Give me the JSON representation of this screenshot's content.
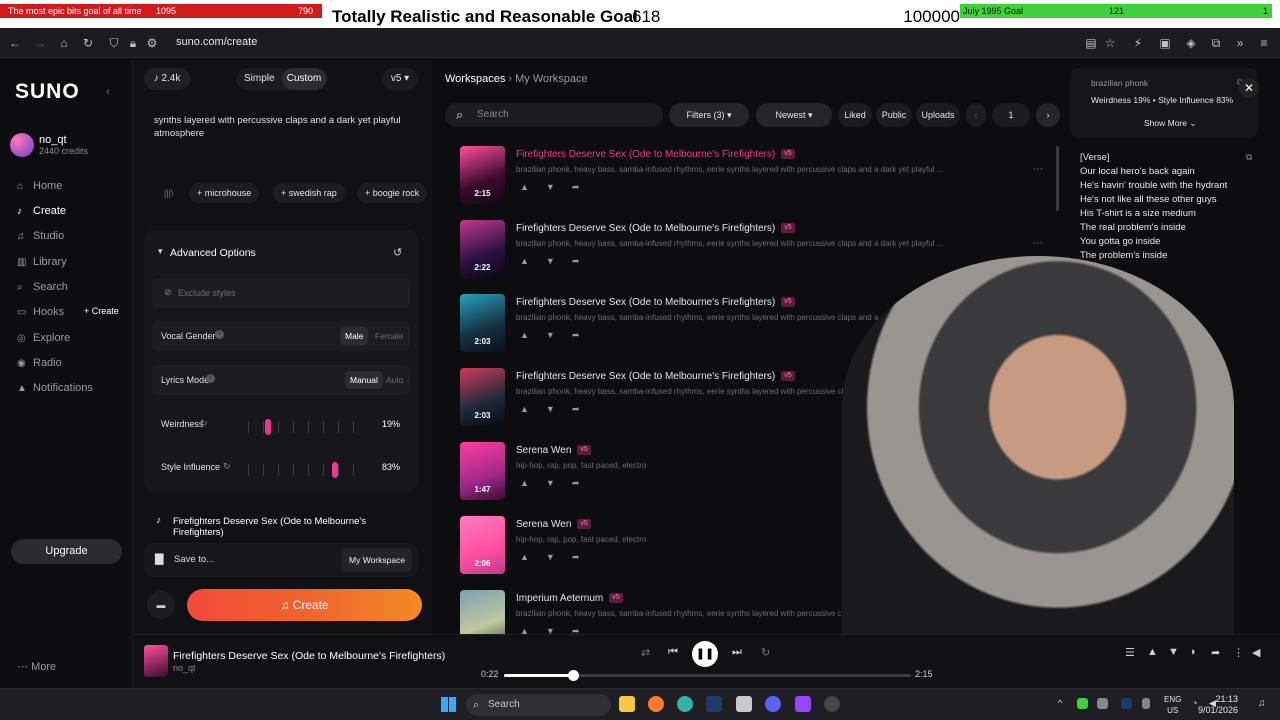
{
  "overlay": {
    "bits_goal_title": "The most epic bits goal of all time",
    "bits_goal_count": "1095",
    "bits_goal_max": "790",
    "main_goal_title": "Totally Realistic and Reasonable Goal",
    "main_goal_count": "618",
    "main_goal_max": "100000",
    "july_goal_title": "July 1995 Goal",
    "july_goal_count": "121",
    "july_goal_max": "1"
  },
  "browser": {
    "url": "suno.com/create"
  },
  "sidebar": {
    "logo": "SUNO",
    "username": "no_qt",
    "credits": "2440 credits",
    "items": [
      {
        "label": "Home",
        "icon": "home-icon"
      },
      {
        "label": "Create",
        "icon": "create-icon"
      },
      {
        "label": "Studio",
        "icon": "studio-icon"
      },
      {
        "label": "Library",
        "icon": "library-icon"
      },
      {
        "label": "Search",
        "icon": "search-icon"
      },
      {
        "label": "Hooks",
        "icon": "hooks-icon"
      },
      {
        "label": "Explore",
        "icon": "explore-icon"
      },
      {
        "label": "Radio",
        "icon": "radio-icon"
      },
      {
        "label": "Notifications",
        "icon": "bell-icon"
      }
    ],
    "hooks_create": "+ Create",
    "upgrade": "Upgrade",
    "more": "More"
  },
  "create": {
    "count": "2.4k",
    "mode_simple": "Simple",
    "mode_custom": "Custom",
    "version": "v5",
    "style_text": "synths layered with percussive claps and a dark yet playful atmosphere",
    "tags": [
      "microhouse",
      "swedish rap",
      "boogie rock"
    ],
    "advanced_label": "Advanced Options",
    "exclude_placeholder": "Exclude styles",
    "vocal_gender_label": "Vocal Gender",
    "vocal_male": "Male",
    "vocal_female": "Female",
    "lyrics_mode_label": "Lyrics Mode",
    "lyrics_manual": "Manual",
    "lyrics_auto": "Auto",
    "weirdness_label": "Weirdness",
    "weirdness_value": "19%",
    "weirdness_level": 0.19,
    "style_influence_label": "Style Influence",
    "style_influence_value": "83%",
    "style_influence_level": 0.83,
    "song_title": "Firefighters Deserve Sex (Ode to Melbourne's Firefighters)",
    "save_to": "Save to...",
    "workspace": "My Workspace",
    "create_button": "Create"
  },
  "workspace": {
    "breadcrumb_root": "Workspaces",
    "breadcrumb_current": "My Workspace",
    "search_placeholder": "Search",
    "filters": "Filters (3)",
    "sort": "Newest",
    "liked": "Liked",
    "public": "Public",
    "uploads": "Uploads",
    "page": "1",
    "tracks": [
      {
        "title": "Firefighters Deserve Sex (Ode to Melbourne's Firefighters)",
        "badge": "v5",
        "tags": "brazilian phonk, heavy bass, samba-infused rhythms, eerie synths layered with percussive claps and a dark yet playful ...",
        "duration": "2:15",
        "active": true
      },
      {
        "title": "Firefighters Deserve Sex (Ode to Melbourne's Firefighters)",
        "badge": "v5",
        "tags": "brazilian phonk, heavy bass, samba-infused rhythms, eerie synths layered with percussive claps and a dark yet playful ...",
        "duration": "2:22",
        "active": false
      },
      {
        "title": "Firefighters Deserve Sex (Ode to Melbourne's Firefighters)",
        "badge": "v5",
        "tags": "brazilian phonk, heavy bass, samba-infused rhythms, eerie synths layered with percussive claps and a dark yet playful ...",
        "duration": "2:03",
        "active": false
      },
      {
        "title": "Firefighters Deserve Sex (Ode to Melbourne's Firefighters)",
        "badge": "v5",
        "tags": "brazilian phonk, heavy bass, samba-infused rhythms, eerie synths layered with percussive claps and a dark yet playful ...",
        "duration": "2:03",
        "active": false
      },
      {
        "title": "Serena Wen",
        "badge": "v5",
        "tags": "hip-hop, rap, pop, fast paced, electro",
        "duration": "1:47",
        "active": false
      },
      {
        "title": "Serena Wen",
        "badge": "v5",
        "tags": "hip-hop, rap, pop, fast paced, electro",
        "duration": "2:06",
        "active": false
      },
      {
        "title": "Imperium Aeternum",
        "badge": "v5",
        "tags": "brazilian phonk, heavy bass, samba-infused rhythms, eerie synths layered with percussive claps and a dark yet playful ...",
        "duration": "",
        "active": false
      }
    ]
  },
  "details": {
    "style": "brazilian phonk",
    "params": "Weirdness 19% • Style Influence 83%",
    "show_more": "Show More",
    "lyrics": [
      "[Verse]",
      "Our local hero's back again",
      "He's havin' trouble with the hydrant",
      "He's not like all these other guys",
      "His T-shirt is a size medium",
      "The real problem's inside",
      "You gotta go inside",
      "The problem's inside"
    ]
  },
  "player": {
    "title": "Firefighters Deserve Sex (Ode to Melbourne's Firefighters)",
    "artist": "no_qt",
    "elapsed": "0:22",
    "total": "2:15",
    "progress": 0.17
  },
  "taskbar": {
    "search": "Search",
    "lang1": "ENG",
    "lang2": "US",
    "time": "21:13",
    "date": "9/01/2026"
  },
  "colors": {
    "accent": "#ea3a8f",
    "create_gradient_start": "#f04a3b",
    "create_gradient_end": "#f28a26",
    "overlay_red": "#d01b1b",
    "overlay_green": "#3fd13b"
  }
}
